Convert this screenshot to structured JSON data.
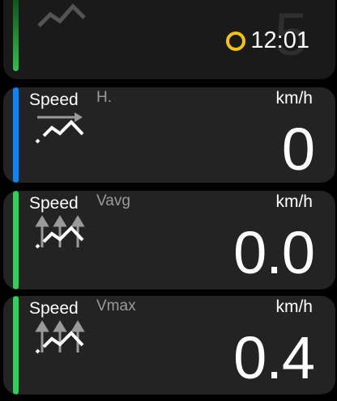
{
  "top_card": {
    "ghost_value": "5",
    "time": "12:01"
  },
  "cards": [
    {
      "title": "Speed",
      "subtitle": "H.",
      "unit": "km/h",
      "value": "0",
      "accent": "#0a84ff",
      "icon": "speed-horizontal-icon"
    },
    {
      "title": "Speed",
      "subtitle": "Vavg",
      "unit": "km/h",
      "value": "0.0",
      "accent": "#30d158",
      "icon": "speed-vertical-avg-icon"
    },
    {
      "title": "Speed",
      "subtitle": "Vmax",
      "unit": "km/h",
      "value": "0.4",
      "accent": "#30d158",
      "icon": "speed-vertical-max-icon"
    }
  ]
}
